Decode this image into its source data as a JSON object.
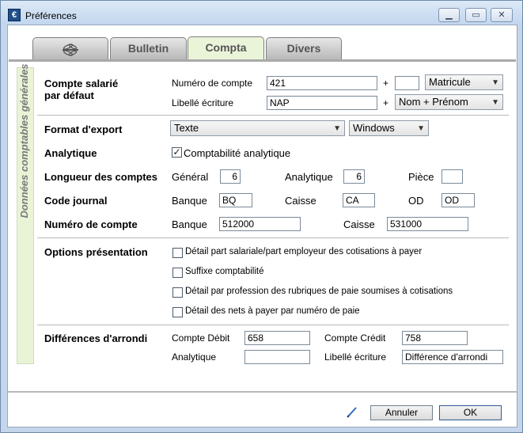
{
  "window": {
    "title": "Préférences",
    "app_icon_glyph": "€"
  },
  "tabs": [
    {
      "label": "",
      "icon": "dragonfly-icon"
    },
    {
      "label": "Bulletin"
    },
    {
      "label": "Compta",
      "active": true
    },
    {
      "label": "Divers"
    }
  ],
  "sidebar": {
    "label": "Données comptables générales"
  },
  "compte_salarie": {
    "title_line1": "Compte salarié",
    "title_line2": "par défaut",
    "numero_label": "Numéro de compte",
    "numero_value": "421",
    "plus1": "+",
    "suffix_value": "",
    "matricule_option": "Matricule",
    "libelle_label": "Libellé écriture",
    "libelle_value": "NAP",
    "plus2": "+",
    "nom_option": "Nom + Prénom"
  },
  "format_export": {
    "label": "Format d'export",
    "format_value": "Texte",
    "system_value": "Windows"
  },
  "analytique": {
    "label": "Analytique",
    "checkbox_label": "Comptabilité analytique",
    "checked": true
  },
  "longueur": {
    "label": "Longueur des comptes",
    "general_label": "Général",
    "general_value": "6",
    "analytique_label": "Analytique",
    "analytique_value": "6",
    "piece_label": "Pièce",
    "piece_value": ""
  },
  "code_journal": {
    "label": "Code journal",
    "banque_label": "Banque",
    "banque_value": "BQ",
    "caisse_label": "Caisse",
    "caisse_value": "CA",
    "od_label": "OD",
    "od_value": "OD"
  },
  "numero_compte": {
    "label": "Numéro de compte",
    "banque_label": "Banque",
    "banque_value": "512000",
    "caisse_label": "Caisse",
    "caisse_value": "531000"
  },
  "options": {
    "label": "Options présentation",
    "items": [
      {
        "label": "Détail part salariale/part employeur des cotisations à payer",
        "checked": false
      },
      {
        "label": "Suffixe comptabilité",
        "checked": false
      },
      {
        "label": "Détail par profession des rubriques de paie soumises à cotisations",
        "checked": false
      },
      {
        "label": "Détail des nets à payer par numéro de paie",
        "checked": false
      }
    ]
  },
  "arrondi": {
    "label": "Différences d'arrondi",
    "compte_debit_label": "Compte Débit",
    "compte_debit_value": "658",
    "compte_credit_label": "Compte Crédit",
    "compte_credit_value": "758",
    "analytique_label": "Analytique",
    "analytique_value": "",
    "libelle_label": "Libellé écriture",
    "libelle_value": "Différence d'arrondi"
  },
  "footer": {
    "cancel_label": "Annuler",
    "ok_label": "OK"
  }
}
